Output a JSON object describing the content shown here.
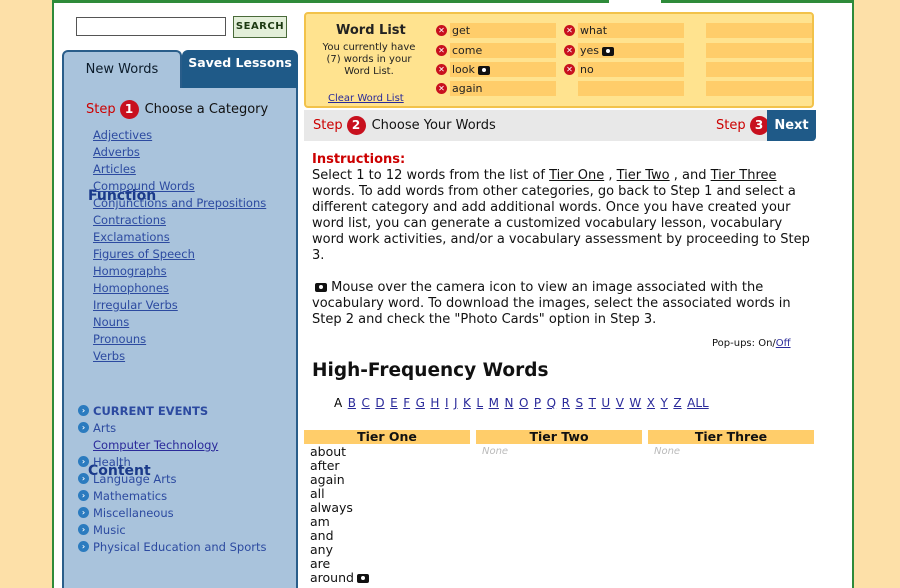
{
  "search": {
    "button_label": "SEARCH",
    "value": ""
  },
  "sidebar": {
    "tabs": {
      "new_words": "New Words",
      "saved_lessons": "Saved Lessons"
    },
    "step1": {
      "step_word": "Step",
      "num": "1",
      "label": "Choose a Category"
    },
    "function": {
      "heading": "Function",
      "items": [
        "Adjectives",
        "Adverbs",
        "Articles",
        "Compound Words",
        "Conjunctions and Prepositions",
        "Contractions",
        "Exclamations",
        "Figures of Speech",
        "Homographs",
        "Homophones",
        "Irregular Verbs",
        "Nouns",
        "Pronouns",
        "Verbs"
      ]
    },
    "content": {
      "heading": "Content",
      "items": [
        {
          "label": "CURRENT EVENTS",
          "bullet": true,
          "bold": true
        },
        {
          "label": "Arts",
          "bullet": true,
          "bold": false
        },
        {
          "label": "Computer Technology",
          "bullet": false,
          "bold": false
        },
        {
          "label": "Health",
          "bullet": true,
          "bold": false
        },
        {
          "label": "Language Arts",
          "bullet": true,
          "bold": false
        },
        {
          "label": "Mathematics",
          "bullet": true,
          "bold": false
        },
        {
          "label": "Miscellaneous",
          "bullet": true,
          "bold": false
        },
        {
          "label": "Music",
          "bullet": true,
          "bold": false
        },
        {
          "label": "Physical Education and Sports",
          "bullet": true,
          "bold": false
        }
      ]
    }
  },
  "word_list": {
    "title": "Word List",
    "count_text": "You currently have (7) words in your Word List.",
    "clear_label": "Clear Word List",
    "col1": [
      {
        "word": "get",
        "cam": false
      },
      {
        "word": "come",
        "cam": false
      },
      {
        "word": "look",
        "cam": true
      },
      {
        "word": "again",
        "cam": false
      }
    ],
    "col2": [
      {
        "word": "what",
        "cam": false
      },
      {
        "word": "yes",
        "cam": true
      },
      {
        "word": "no",
        "cam": false
      }
    ]
  },
  "step2": {
    "step_word": "Step",
    "num": "2",
    "label": "Choose Your Words"
  },
  "step3": {
    "step_word": "Step",
    "num": "3",
    "next_label": "Next"
  },
  "instructions": {
    "heading": "Instructions:",
    "p1_a": "Select 1 to 12 words from the list of ",
    "tier_one": "Tier One",
    "sep1": " , ",
    "tier_two": "Tier Two",
    "sep2": " , and ",
    "tier_three": "Tier Three",
    "p1_b": " words. To add words from other categories, go back to Step 1 and select a different category and add additional words. Once you have created your word list, you can generate a customized vocabulary lesson, vocabulary word work activities, and/or a vocabulary assessment by proceeding to Step 3.",
    "p2": " Mouse over the camera icon to view an image associated with the vocabulary word. To download the images, select the associated words in Step 2 and check the \"Photo Cards\" option in Step 3."
  },
  "popups": {
    "label": "Pop-ups: On/",
    "off": "Off"
  },
  "section_title": "High-Frequency Words",
  "alphabet": [
    "A",
    "B",
    "C",
    "D",
    "E",
    "F",
    "G",
    "H",
    "I",
    "J",
    "K",
    "L",
    "M",
    "N",
    "O",
    "P",
    "Q",
    "R",
    "S",
    "T",
    "U",
    "V",
    "W",
    "X",
    "Y",
    "Z",
    "ALL"
  ],
  "tiers": {
    "one": "Tier One",
    "two": "Tier Two",
    "three": "Tier Three",
    "none": "None"
  },
  "tier_one_words": [
    {
      "word": "about",
      "cam": false
    },
    {
      "word": "after",
      "cam": false
    },
    {
      "word": "again",
      "cam": false
    },
    {
      "word": "all",
      "cam": false
    },
    {
      "word": "always",
      "cam": false
    },
    {
      "word": "am",
      "cam": false
    },
    {
      "word": "and",
      "cam": false
    },
    {
      "word": "any",
      "cam": false
    },
    {
      "word": "are",
      "cam": false
    },
    {
      "word": "around",
      "cam": true
    }
  ],
  "colors": {
    "accent_green": "#2e8b3a",
    "nav_blue": "#1f5a88",
    "panel_blue": "#a9c3dc",
    "wordlist_yellow": "#ffe38f",
    "step_red": "#c8101e"
  }
}
